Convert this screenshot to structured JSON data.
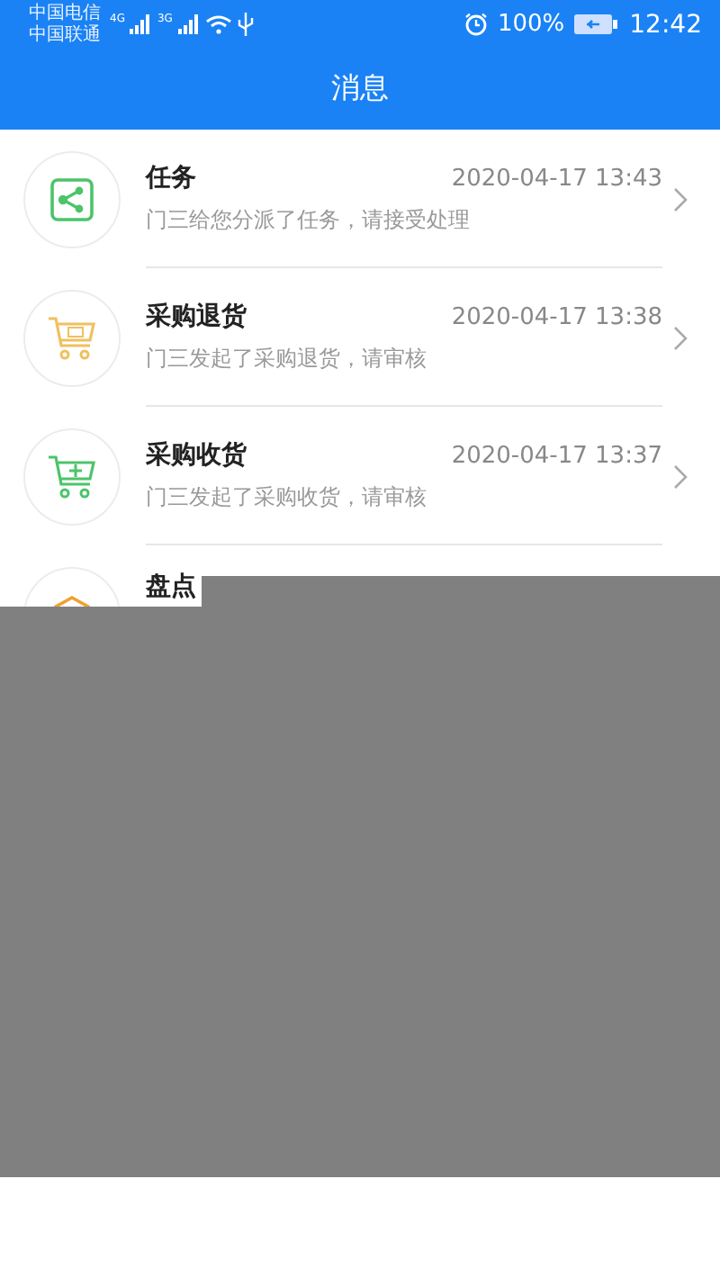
{
  "status_bar": {
    "carriers": [
      {
        "name": "中国电信",
        "network": "4G"
      },
      {
        "name": "中国联通",
        "network": "3G"
      }
    ],
    "battery": "100%",
    "time": "12:42"
  },
  "header": {
    "title": "消息"
  },
  "messages": [
    {
      "kind": "task",
      "title": "任务",
      "time": "2020-04-17 13:43",
      "text": "门三给您分派了任务，请接受处理"
    },
    {
      "kind": "return",
      "title": "采购退货",
      "time": "2020-04-17 13:38",
      "text": "门三发起了采购退货，请审核"
    },
    {
      "kind": "receive",
      "title": "采购收货",
      "time": "2020-04-17 13:37",
      "text": "门三发起了采购收货，请审核"
    },
    {
      "kind": "count",
      "title": "盘点"
    }
  ]
}
